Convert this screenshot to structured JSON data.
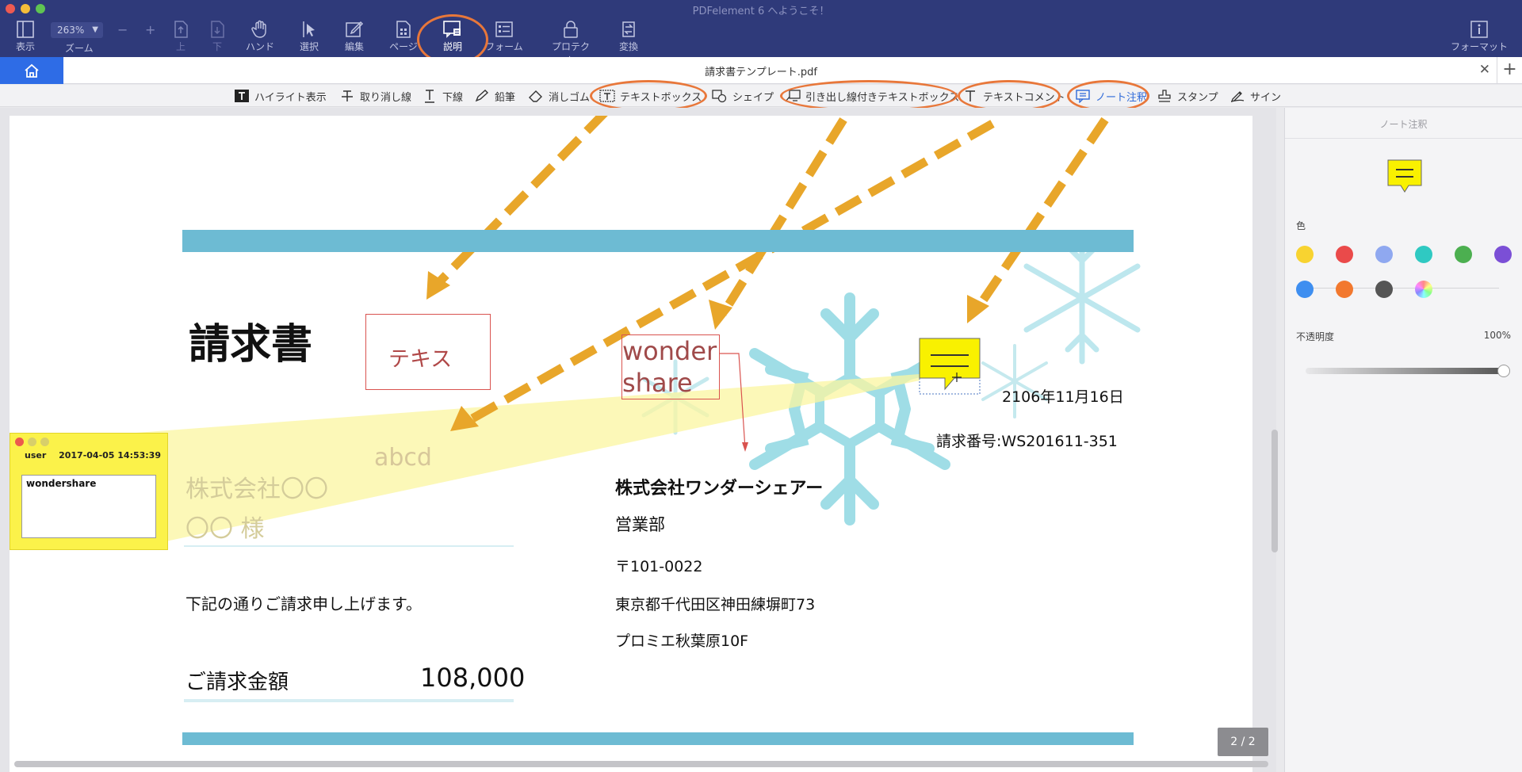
{
  "app": {
    "title": "PDFelement 6 へようこそ！"
  },
  "toolbar": {
    "zoom_value": "263%",
    "zoom_label": "ズーム",
    "zoom_minus": "−",
    "zoom_plus": "+",
    "items": [
      {
        "label": "表示",
        "icon": "panel-icon"
      },
      {
        "label": "上",
        "icon": "page-up-icon"
      },
      {
        "label": "下",
        "icon": "page-down-icon"
      },
      {
        "label": "ハンド",
        "icon": "hand-icon"
      },
      {
        "label": "選択",
        "icon": "select-arrow-icon"
      },
      {
        "label": "編集",
        "icon": "edit-icon"
      },
      {
        "label": "ページ",
        "icon": "pages-icon"
      },
      {
        "label": "説明",
        "icon": "comment-icon"
      },
      {
        "label": "フォーム",
        "icon": "form-icon"
      },
      {
        "label": "プロテクト",
        "icon": "lock-icon"
      },
      {
        "label": "変換",
        "icon": "convert-icon"
      },
      {
        "label": "フォーマット",
        "icon": "info-icon"
      }
    ]
  },
  "tabs": {
    "document_title": "請求書テンプレート.pdf",
    "close": "✕",
    "add": "+"
  },
  "annotation_tools": [
    {
      "label": "ハイライト表示",
      "icon": "highlight-icon"
    },
    {
      "label": "取り消し線",
      "icon": "strikethrough-icon"
    },
    {
      "label": "下線",
      "icon": "underline-icon"
    },
    {
      "label": "鉛筆",
      "icon": "pencil-icon"
    },
    {
      "label": "消しゴム",
      "icon": "eraser-icon"
    },
    {
      "label": "テキストボックス",
      "icon": "textbox-icon"
    },
    {
      "label": "シェイプ",
      "icon": "shape-icon"
    },
    {
      "label": "引き出し線付きテキストボックス",
      "icon": "callout-icon"
    },
    {
      "label": "テキストコメント",
      "icon": "text-comment-icon"
    },
    {
      "label": "ノート注釈",
      "icon": "note-icon"
    },
    {
      "label": "スタンプ",
      "icon": "stamp-icon"
    },
    {
      "label": "サイン",
      "icon": "signature-icon"
    }
  ],
  "document": {
    "heading": "請求書",
    "textbox_text": "テキス",
    "callout_line1": "wonder",
    "callout_line2": "share",
    "comment_text": "abcd",
    "date": "2106年11月16日",
    "invoice_no": "請求番号:WS201611-351",
    "client_company": "株式会社〇〇",
    "client_name": "〇〇 様",
    "greeting": "下記の通りご請求申し上げます。",
    "amount_label": "ご請求金額",
    "amount_value": "108,000",
    "sender_company": "株式会社ワンダーシェアー",
    "sender_dept": "営業部",
    "sender_zip": "〒101-0022",
    "sender_address": "東京都千代田区神田練塀町73",
    "sender_building": "プロミエ秋葉原10F"
  },
  "sticky_note": {
    "user": "user",
    "timestamp": "2017-04-05 14:53:39",
    "content": "wondershare"
  },
  "page_indicator": "2 / 2",
  "properties_panel": {
    "title": "ノート注釈",
    "color_label": "色",
    "colors": [
      "#f8d330",
      "#ea4a4a",
      "#8fa8f0",
      "#2fc9c2",
      "#4caf50",
      "#7b4fd6",
      "#3e8ef0",
      "#f2782e",
      "#555555"
    ],
    "opacity_label": "不透明度",
    "opacity_value": "100%"
  }
}
